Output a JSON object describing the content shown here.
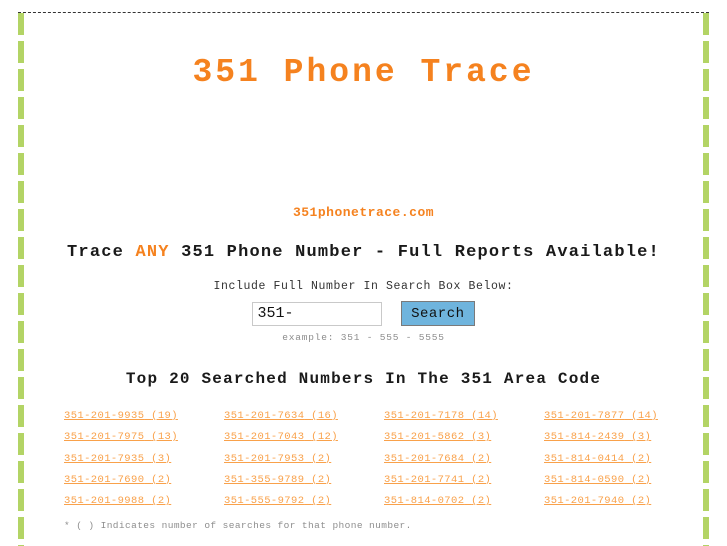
{
  "site": {
    "title": "351 Phone Trace",
    "domain_line": "351phonetrace.com",
    "title_color": "#f5821f",
    "link_color": "#f9a14a",
    "rail_color": "#b3d465",
    "button_color": "#6fb4dd"
  },
  "tagline": {
    "before": "Trace ",
    "highlight": "ANY",
    "after": " 351 Phone Number - Full Reports Available!"
  },
  "search": {
    "label": "Include Full Number In Search Box Below:",
    "input_value": "351-",
    "input_placeholder": "351-",
    "button_label": "Search",
    "example": "example: 351 - 555 - 5555"
  },
  "top_list": {
    "heading": "Top 20 Searched Numbers In The 351 Area Code",
    "footnote": "* ( ) Indicates number of searches for that phone number.",
    "rows": [
      [
        {
          "number": "351-201-9935",
          "count": "(19)"
        },
        {
          "number": "351-201-7634",
          "count": "(16)"
        },
        {
          "number": "351-201-7178",
          "count": "(14)"
        },
        {
          "number": "351-201-7877",
          "count": "(14)"
        }
      ],
      [
        {
          "number": "351-201-7975",
          "count": "(13)"
        },
        {
          "number": "351-201-7043",
          "count": "(12)"
        },
        {
          "number": "351-201-5862",
          "count": "(3)"
        },
        {
          "number": "351-814-2439",
          "count": "(3)"
        }
      ],
      [
        {
          "number": "351-201-7935",
          "count": "(3)"
        },
        {
          "number": "351-201-7953",
          "count": "(2)"
        },
        {
          "number": "351-201-7684",
          "count": "(2)"
        },
        {
          "number": "351-814-0414",
          "count": "(2)"
        }
      ],
      [
        {
          "number": "351-201-7690",
          "count": "(2)"
        },
        {
          "number": "351-355-9789",
          "count": "(2)"
        },
        {
          "number": "351-201-7741",
          "count": "(2)"
        },
        {
          "number": "351-814-0590",
          "count": "(2)"
        }
      ],
      [
        {
          "number": "351-201-9988",
          "count": "(2)"
        },
        {
          "number": "351-555-9792",
          "count": "(2)"
        },
        {
          "number": "351-814-0702",
          "count": "(2)"
        },
        {
          "number": "351-201-7940",
          "count": "(2)"
        }
      ]
    ]
  }
}
